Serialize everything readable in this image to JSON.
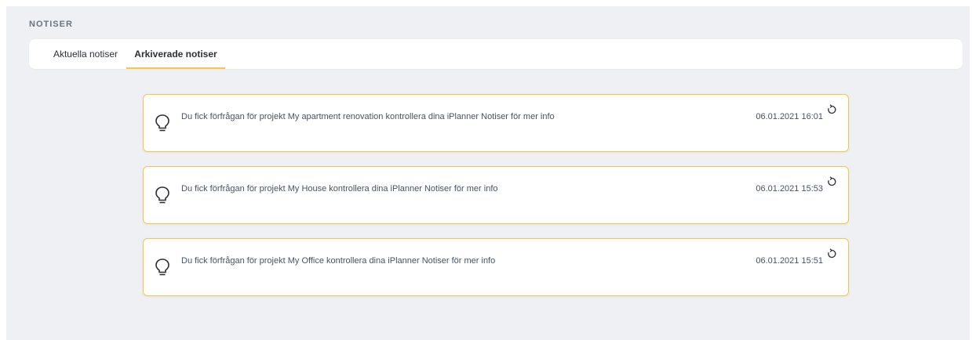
{
  "section": {
    "title": "NOTISER"
  },
  "tabs": [
    {
      "label": "Aktuella notiser",
      "active": false
    },
    {
      "label": "Arkiverade notiser",
      "active": true
    }
  ],
  "notifications": [
    {
      "icon": "lightbulb-icon",
      "message": "Du fick förfrågan för projekt My apartment renovation kontrollera dina iPlanner Notiser för mer info",
      "timestamp": "06.01.2021 16:01",
      "action_icon": "restore-icon"
    },
    {
      "icon": "lightbulb-icon",
      "message": "Du fick förfrågan för projekt My House kontrollera dina iPlanner Notiser för mer info",
      "timestamp": "06.01.2021 15:53",
      "action_icon": "restore-icon"
    },
    {
      "icon": "lightbulb-icon",
      "message": "Du fick förfrågan för projekt My Office kontrollera dina iPlanner Notiser för mer info",
      "timestamp": "06.01.2021 15:51",
      "action_icon": "restore-icon"
    }
  ],
  "colors": {
    "accent": "#f5c84c",
    "card_border": "#f3c74a",
    "panel_bg": "#eef0f3"
  }
}
